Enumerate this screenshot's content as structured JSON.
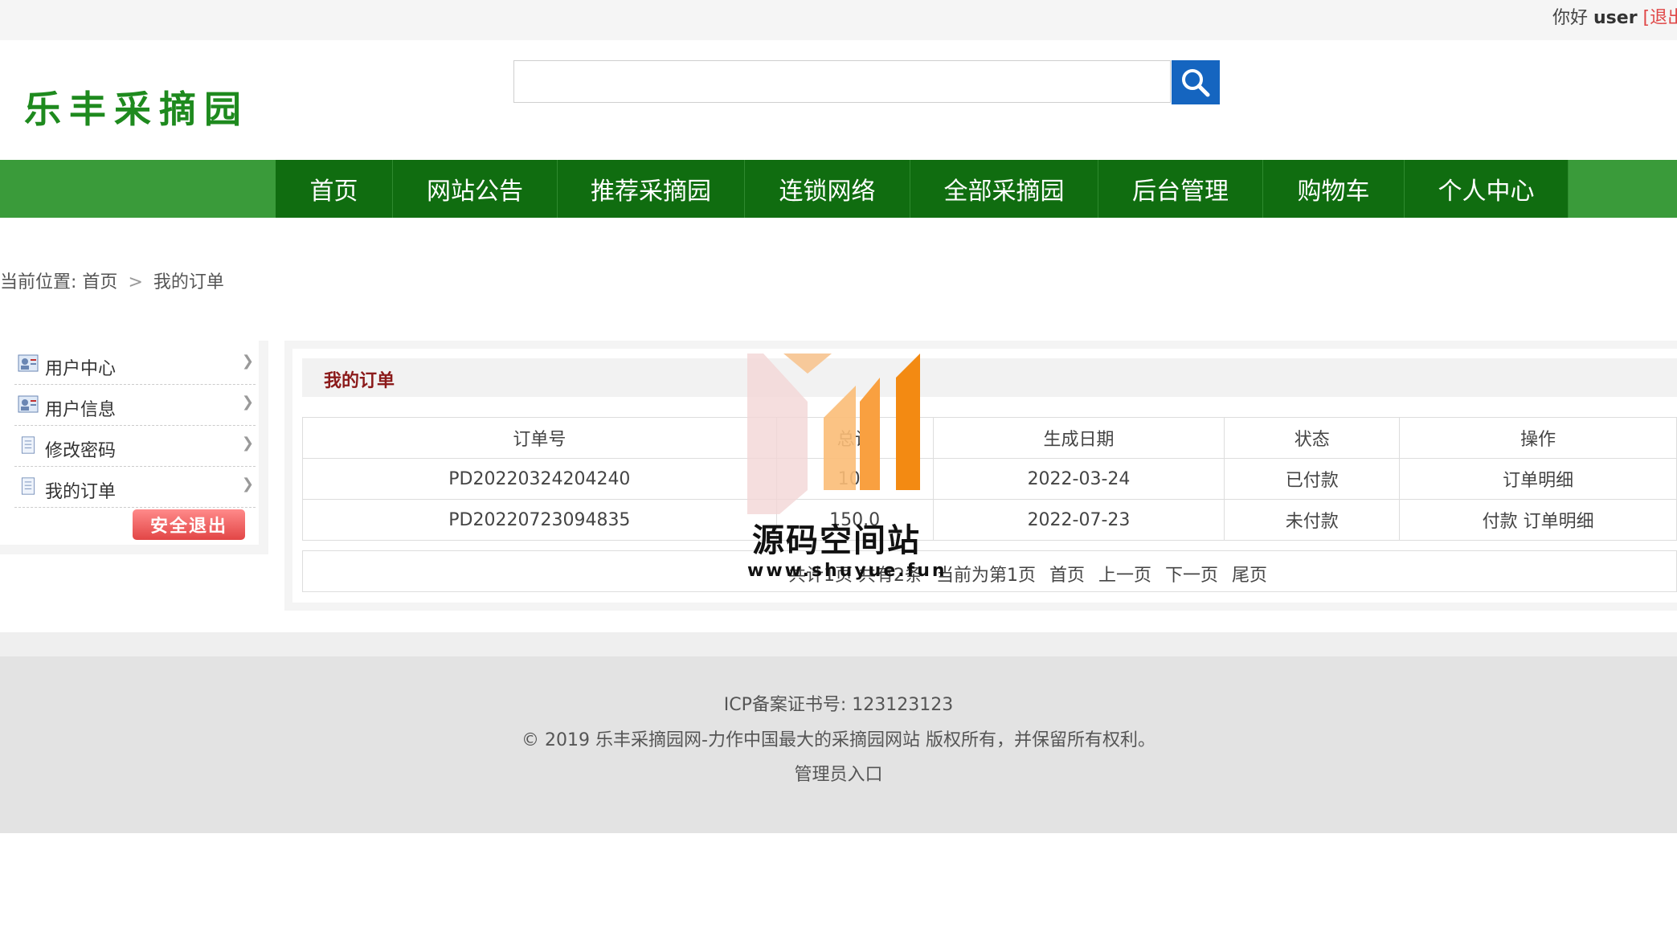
{
  "topbar": {
    "greeting": "你好",
    "username": "user",
    "logout": "[退出]"
  },
  "logo": {
    "text": "乐丰采摘园"
  },
  "nav": {
    "items": [
      "首页",
      "网站公告",
      "推荐采摘园",
      "连锁网络",
      "全部采摘园",
      "后台管理",
      "购物车",
      "个人中心"
    ]
  },
  "breadcrumb": {
    "prefix": "当前位置:",
    "home": "首页",
    "sep": ">",
    "current": "我的订单"
  },
  "sidebar": {
    "items": [
      {
        "label": "用户中心",
        "icon": "user-card-icon"
      },
      {
        "label": "用户信息",
        "icon": "user-card-icon"
      },
      {
        "label": "修改密码",
        "icon": "document-icon"
      },
      {
        "label": "我的订单",
        "icon": "document-icon"
      }
    ],
    "logout_button": "安全退出"
  },
  "main": {
    "title": "我的订单",
    "columns": [
      "订单号",
      "总计",
      "生成日期",
      "状态",
      "操作"
    ],
    "rows": [
      {
        "order_no": "PD20220324204240",
        "total": "100",
        "date": "2022-03-24",
        "status": "已付款",
        "actions": [
          "订单明细"
        ]
      },
      {
        "order_no": "PD20220723094835",
        "total": "150.0",
        "date": "2022-07-23",
        "status": "未付款",
        "actions": [
          "付款",
          "订单明细"
        ]
      }
    ],
    "pager": {
      "summary": "共计1页 共有2条",
      "current": "当前为第1页",
      "first": "首页",
      "prev": "上一页",
      "next": "下一页",
      "last": "尾页"
    }
  },
  "footer": {
    "icp": "ICP备案证书号: 123123123",
    "copyright": "© 2019 乐丰采摘园网-力作中国最大的采摘园网站 版权所有，并保留所有权利。",
    "admin_link": "管理员入口"
  },
  "watermark": {
    "title": "源码空间站",
    "url": "www.shuyue.fun"
  },
  "colors": {
    "nav_bg": "#3a9b3a",
    "nav_inner": "#106d10",
    "search_btn": "#1565c0",
    "title_red": "#8b1a1a",
    "logout_red": "#e24646"
  }
}
